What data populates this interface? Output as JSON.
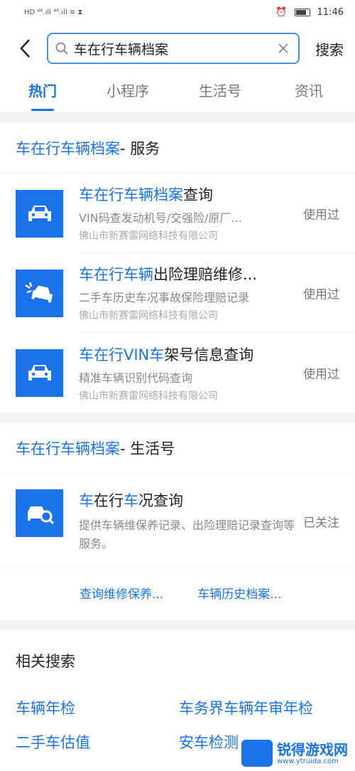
{
  "statusbar": {
    "left": "HD ⁴⁶.ıll ⁴⁶.ıll ≋ ⧗",
    "time": "11:46"
  },
  "header": {
    "search_value": "车在行车辆档案",
    "search_label": "搜索"
  },
  "tabs": [
    {
      "label": "热门"
    },
    {
      "label": "小程序"
    },
    {
      "label": "生活号"
    },
    {
      "label": "资讯"
    }
  ],
  "services": {
    "title_hl": "车在行车辆档案",
    "title_rest": " - 服务",
    "items": [
      {
        "title_hl": "车在行车辆档案",
        "title_rest": "查询",
        "desc": "VIN码查发动机号/交强险/原厂...",
        "org": "佛山市新赛雷网络科技有限公司",
        "status": "使用过"
      },
      {
        "title_hl": "车在行车辆",
        "title_rest": "出险理赔维修...",
        "desc": "二手车历史车况事故保险理赔记录",
        "org": "佛山市新赛雷网络科技有限公司",
        "status": "使用过"
      },
      {
        "title_hl": "车在行VIN车",
        "title_rest": "架号信息查询",
        "desc": "精准车辆识别代码查询",
        "org": "佛山市新赛雷网络科技有限公司",
        "status": "使用过"
      }
    ]
  },
  "life": {
    "title_hl": "车在行车辆档案",
    "title_rest": " - 生活号",
    "item": {
      "title_hl": "车",
      "title_mid": "在行",
      "title_hl2": "车",
      "title_rest": "况查询",
      "desc": "提供车辆维保养记录、出险理赔记录查询等服务。",
      "status": "已关注"
    },
    "links": [
      "查询维修保养...",
      "车辆历史档案..."
    ]
  },
  "related": {
    "title": "相关搜索",
    "items": [
      "车辆年检",
      "车务界车辆年审年检",
      "二手车估值",
      "安车检测"
    ]
  },
  "watermark": {
    "text": "锐得游戏网",
    "url": "www.ytruida.com"
  },
  "colors": {
    "accent": "#1a73e8",
    "background": "#f2f2f2"
  }
}
